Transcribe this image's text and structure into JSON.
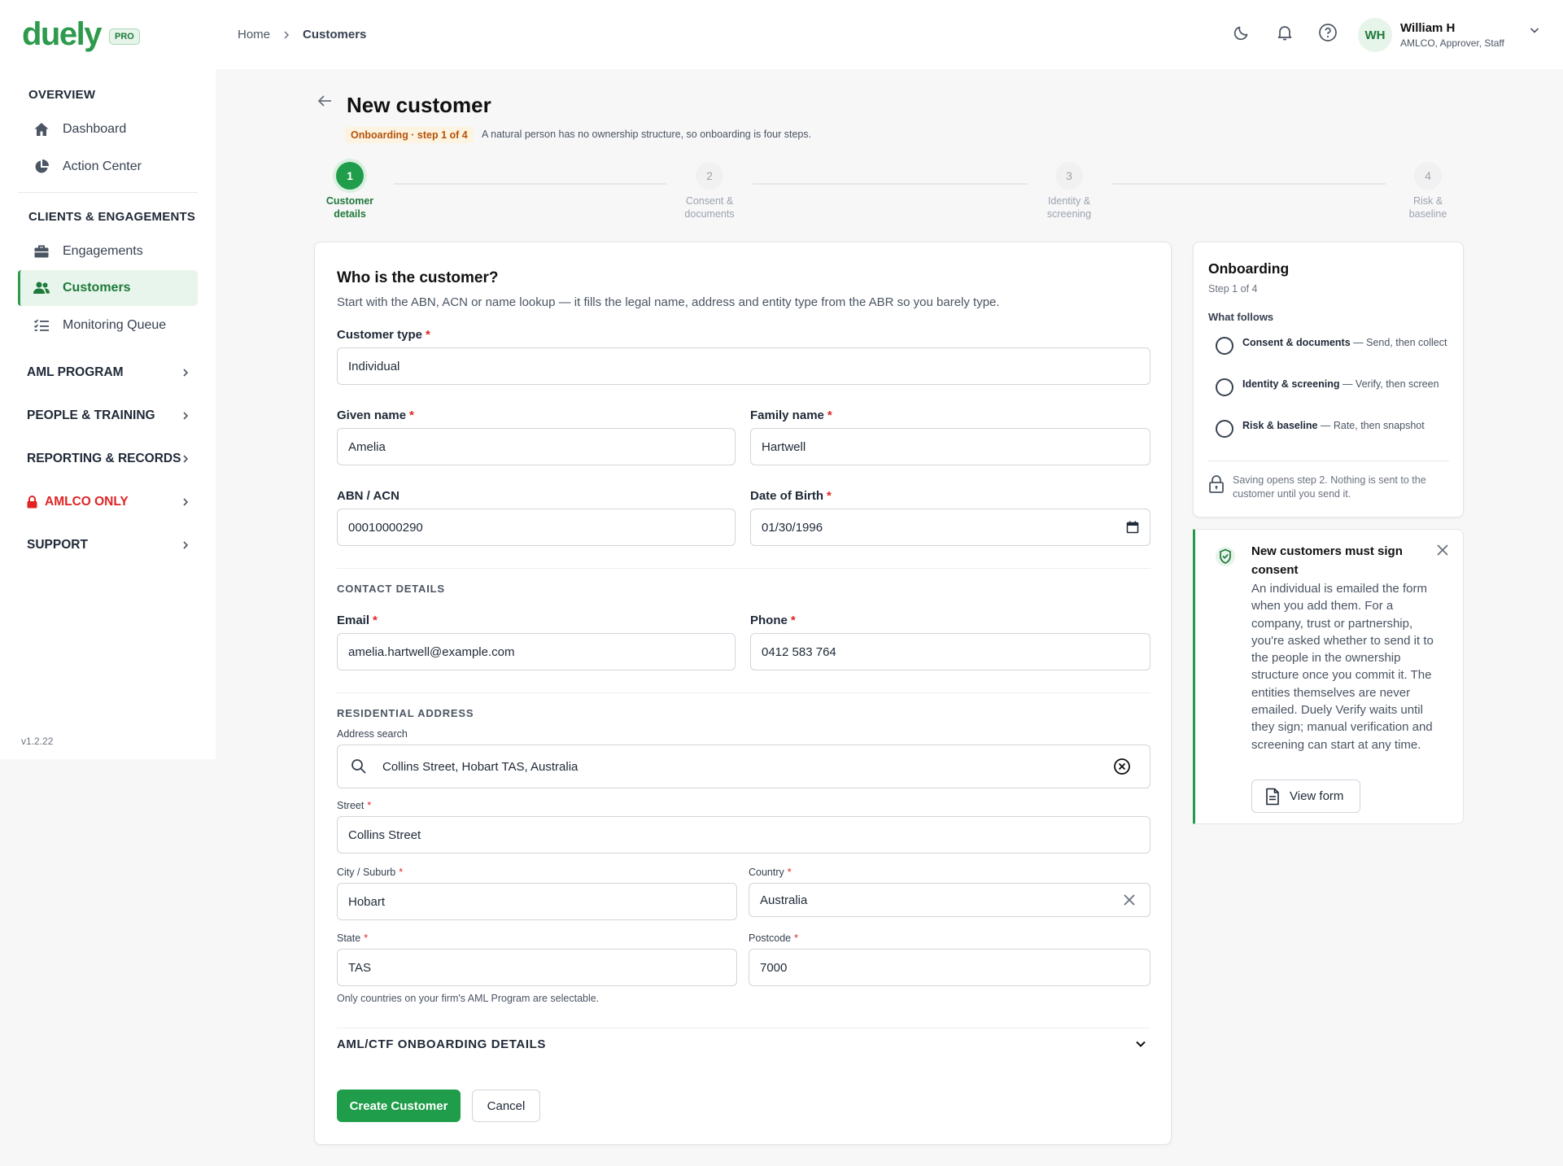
{
  "brand": {
    "name": "duely",
    "badge": "PRO"
  },
  "sidebar": {
    "overview_title": "OVERVIEW",
    "overview_items": [
      {
        "label": "Dashboard",
        "icon": "home-icon"
      },
      {
        "label": "Action Center",
        "icon": "pie-chart-icon"
      }
    ],
    "clients_title": "CLIENTS & ENGAGEMENTS",
    "clients_items": [
      {
        "label": "Engagements",
        "icon": "briefcase-icon"
      },
      {
        "label": "Customers",
        "icon": "users-icon",
        "active": true
      },
      {
        "label": "Monitoring Queue",
        "icon": "list-check-icon"
      }
    ],
    "groups": [
      {
        "label": "AML PROGRAM"
      },
      {
        "label": "PEOPLE & TRAINING"
      },
      {
        "label": "REPORTING & RECORDS"
      },
      {
        "label": "AMLCO ONLY",
        "icon": "lock-icon",
        "color": "#e02424"
      },
      {
        "label": "SUPPORT"
      }
    ],
    "version": "v1.2.22"
  },
  "topbar": {
    "breadcrumb": [
      "Home",
      "Customers"
    ],
    "user": {
      "initials": "WH",
      "name": "William H",
      "role": "AMLCO, Approver, Staff"
    }
  },
  "page": {
    "title": "New customer",
    "step_badge": "Onboarding · step 1 of 4",
    "step_note": "A natural person has no ownership structure, so onboarding is four steps."
  },
  "stepper": [
    {
      "num": "1",
      "line1": "Customer",
      "line2": "details",
      "active": true
    },
    {
      "num": "2",
      "line1": "Consent &",
      "line2": "documents"
    },
    {
      "num": "3",
      "line1": "Identity &",
      "line2": "screening"
    },
    {
      "num": "4",
      "line1": "Risk &",
      "line2": "baseline"
    }
  ],
  "form": {
    "title": "Who is the customer?",
    "subtitle": "Start with the ABN, ACN or name lookup — it fills the legal name, address and entity type from the ABR so you barely type.",
    "customer_type": {
      "label": "Customer type",
      "value": "Individual"
    },
    "given_name": {
      "label": "Given name",
      "value": "Amelia"
    },
    "family_name": {
      "label": "Family name",
      "value": "Hartwell"
    },
    "abn": {
      "label": "ABN / ACN",
      "value": "00010000290"
    },
    "dob": {
      "label": "Date of Birth",
      "value": "01/30/1996"
    },
    "contact_heading": "CONTACT DETAILS",
    "email": {
      "label": "Email",
      "value": "amelia.hartwell@example.com"
    },
    "phone": {
      "label": "Phone",
      "value": "0412 583 764"
    },
    "address_heading": "RESIDENTIAL ADDRESS",
    "address_search": {
      "label": "Address search",
      "value": "Collins Street, Hobart TAS, Australia"
    },
    "street": {
      "label": "Street",
      "value": "Collins Street"
    },
    "city": {
      "label": "City / Suburb",
      "value": "Hobart"
    },
    "country": {
      "label": "Country",
      "value": "Australia"
    },
    "state": {
      "label": "State",
      "value": "TAS"
    },
    "postcode": {
      "label": "Postcode",
      "value": "7000"
    },
    "country_helper": "Only countries on your firm's AML Program are selectable.",
    "accordion_label": "AML/CTF ONBOARDING DETAILS",
    "create_label": "Create Customer",
    "cancel_label": "Cancel"
  },
  "onboarding": {
    "title": "Onboarding",
    "subtitle": "Step 1 of 4",
    "follows_label": "What follows",
    "items": [
      {
        "bold": "Consent & documents",
        "rest": " — Send, then collect"
      },
      {
        "bold": "Identity & screening",
        "rest": " — Verify, then screen"
      },
      {
        "bold": "Risk & baseline",
        "rest": " — Rate, then snapshot"
      }
    ],
    "note": "Saving opens step 2. Nothing is sent to the customer until you send it."
  },
  "consent": {
    "title": "New customers must sign consent",
    "body": "An individual is emailed the form when you add them. For a company, trust or partnership, you're asked whether to send it to the people in the ownership structure once you commit it. The entities themselves are never emailed. Duely Verify waits until they sign; manual verification and screening can start at any time.",
    "view_form_label": "View form"
  },
  "colors": {
    "accent": "#1f9d4a",
    "brand": "#2d9a4c",
    "danger": "#e02424",
    "warning": "#b45309"
  }
}
